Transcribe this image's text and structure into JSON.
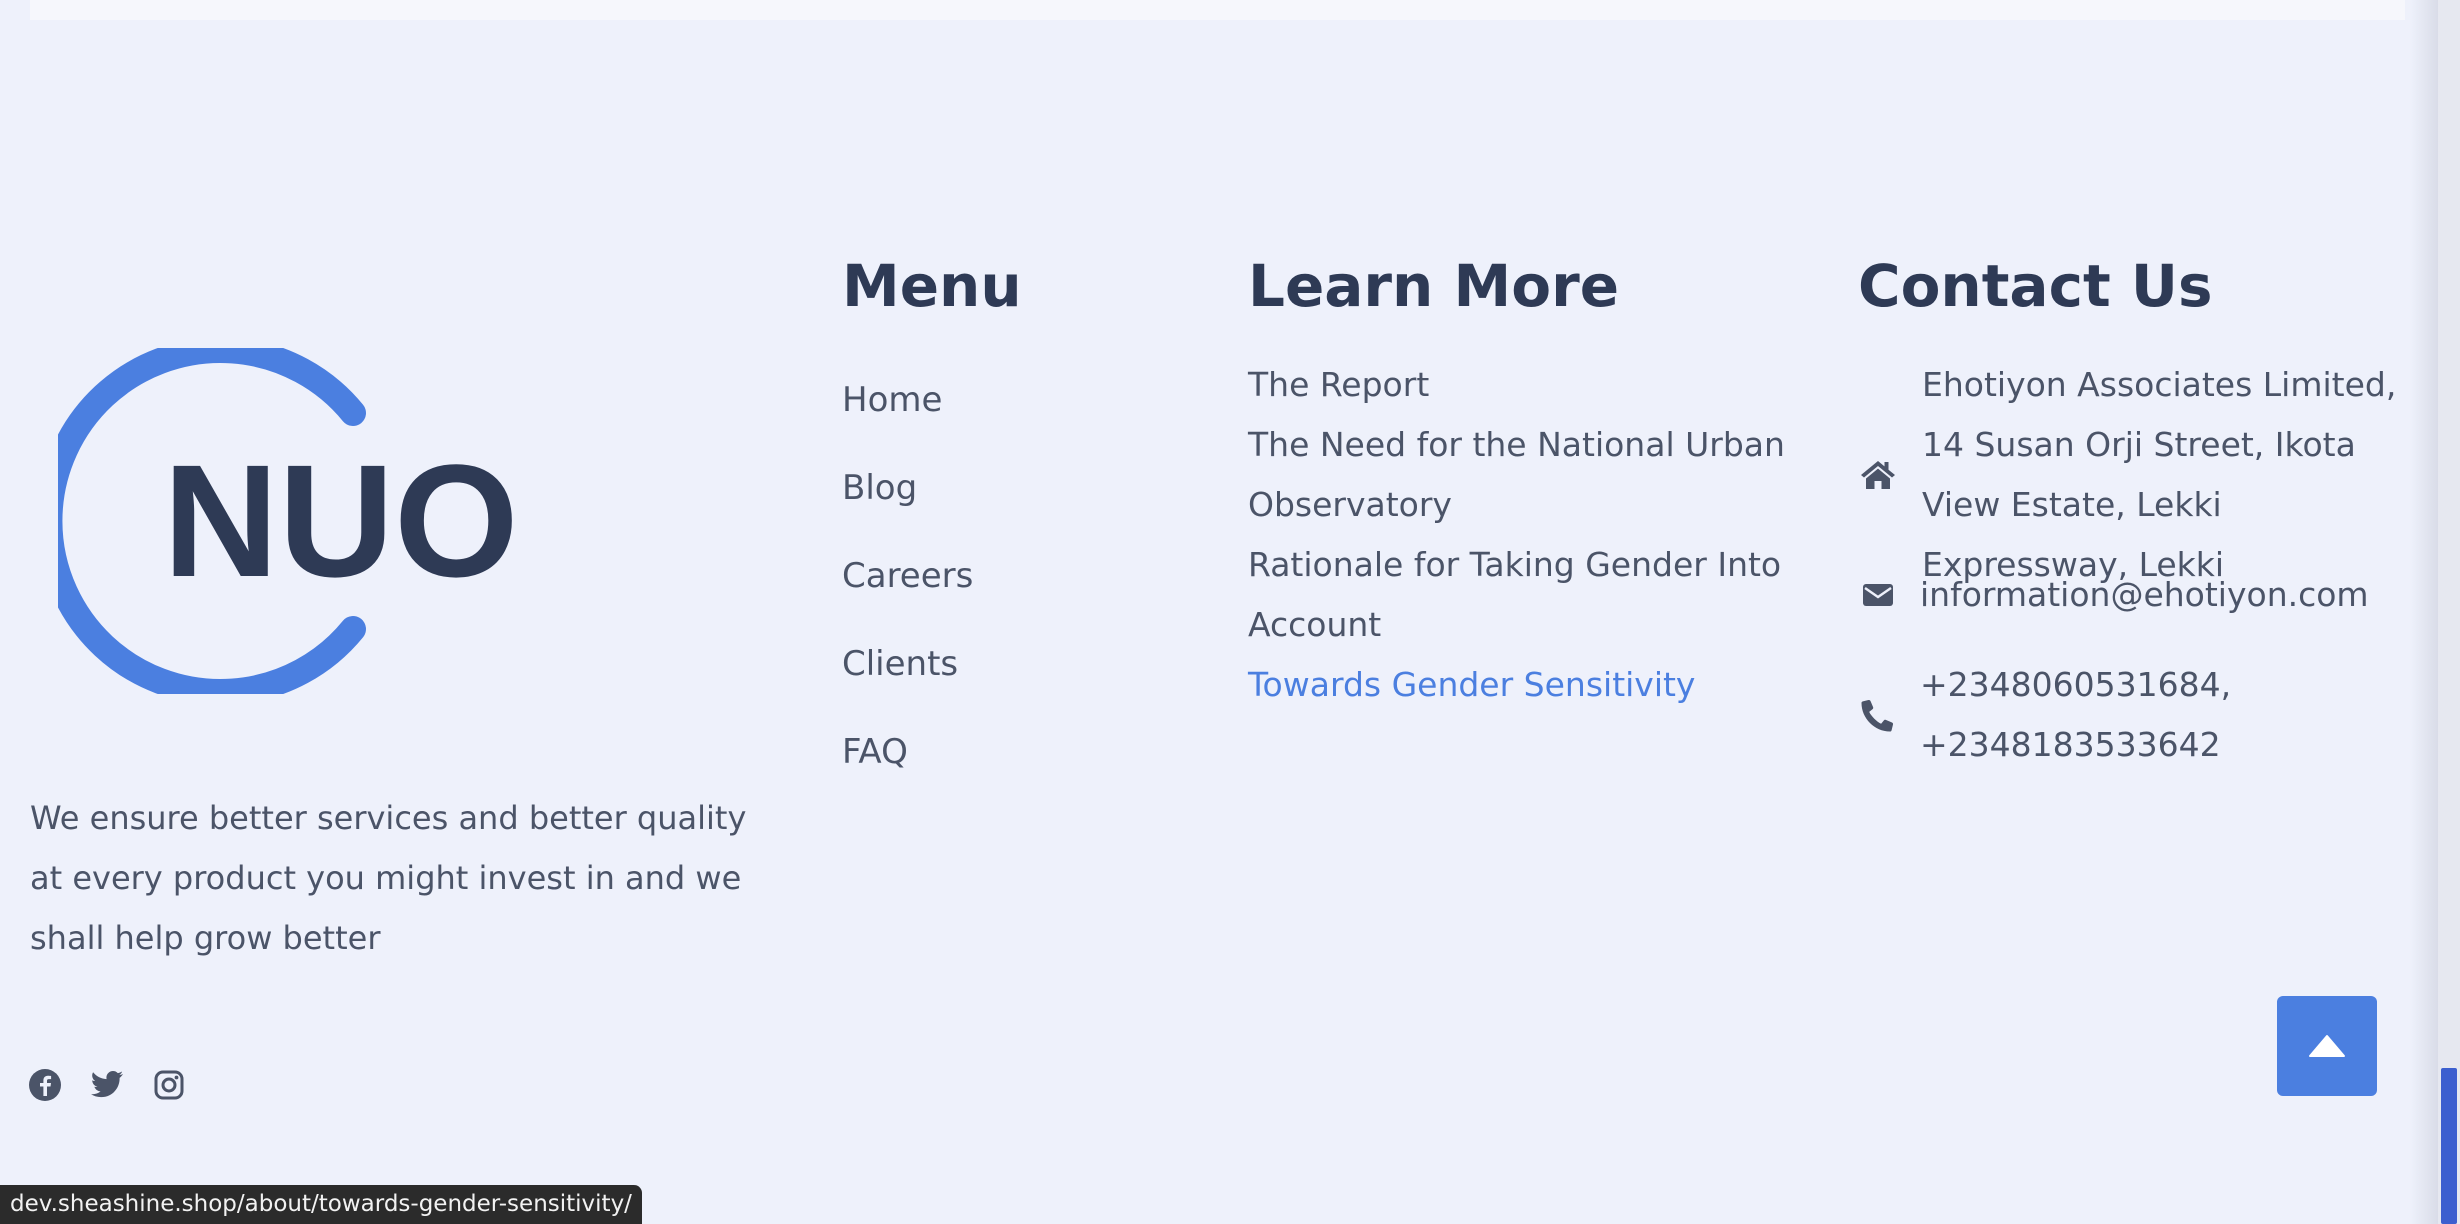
{
  "brand": {
    "logo_text": "NUO",
    "ring_color": "#4b7fe0",
    "text_color": "#2e3a55"
  },
  "about": {
    "text": "We ensure better services and better quality at every product you might invest in and we shall help grow better"
  },
  "social": [
    {
      "name": "facebook",
      "icon": "facebook-icon"
    },
    {
      "name": "twitter",
      "icon": "twitter-icon"
    },
    {
      "name": "instagram",
      "icon": "instagram-icon"
    }
  ],
  "menu": {
    "title": "Menu",
    "items": [
      "Home",
      "Blog",
      "Careers",
      "Clients",
      "FAQ"
    ]
  },
  "learn_more": {
    "title": "Learn More",
    "items": [
      {
        "label": "The Report"
      },
      {
        "label": "The Need for the National Urban Observatory"
      },
      {
        "label": "Rationale for Taking Gender Into Account"
      },
      {
        "label": "Towards Gender Sensitivity",
        "active": true
      }
    ]
  },
  "contact": {
    "title": "Contact Us",
    "address": "Ehotiyon Associates Limited, 14 Susan Orji Street, Ikota View Estate, Lekki Expressway, Lekki",
    "email": "information@ehotiyon.com",
    "phone": "+2348060531684, +2348183533642"
  },
  "back_to_top": {
    "icon": "caret-up-icon"
  },
  "status_bar": {
    "url": "dev.sheashine.shop/about/towards-gender-sensitivity/"
  },
  "colors": {
    "accent": "#4b7fe0",
    "heading": "#2e3a55",
    "body_text": "#4b5468",
    "background": "#eef1fb"
  }
}
